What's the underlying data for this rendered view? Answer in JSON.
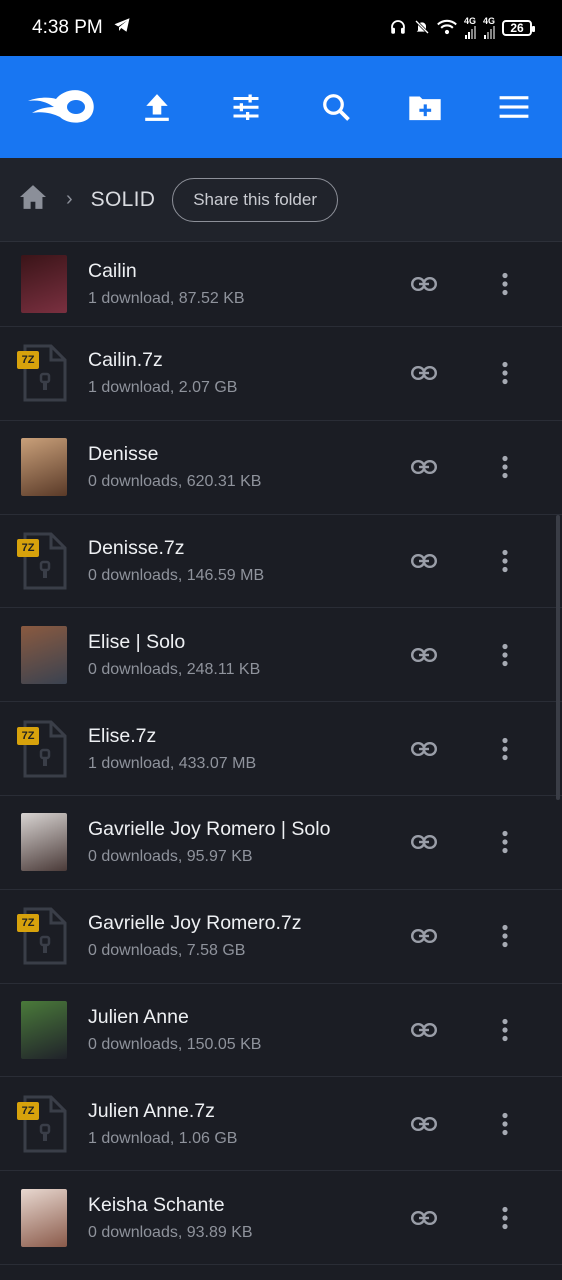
{
  "status_bar": {
    "time": "4:38 PM",
    "network_1": "4G",
    "network_2": "4G",
    "battery": "26"
  },
  "app_bar": {
    "icons": [
      "mediafire-logo",
      "upload-icon",
      "filter-icon",
      "search-icon",
      "new-folder-icon",
      "menu-icon"
    ]
  },
  "breadcrumb": {
    "folder": "SOLID",
    "share_label": "Share this folder"
  },
  "files": [
    {
      "name": "Cailin",
      "info": "1 download, 87.52 KB",
      "type": "image",
      "colors": [
        "#3a1418",
        "#7a3040"
      ]
    },
    {
      "name": "Cailin.7z",
      "info": "1 download, 2.07 GB",
      "type": "7z",
      "badge": "7Z"
    },
    {
      "name": "Denisse",
      "info": "0 downloads, 620.31 KB",
      "type": "image",
      "colors": [
        "#c9a07a",
        "#5a3a28"
      ]
    },
    {
      "name": "Denisse.7z",
      "info": "0 downloads, 146.59 MB",
      "type": "7z",
      "badge": "7Z"
    },
    {
      "name": "Elise | Solo",
      "info": "0 downloads, 248.11 KB",
      "type": "image",
      "colors": [
        "#8a5a40",
        "#3a4250"
      ]
    },
    {
      "name": "Elise.7z",
      "info": "1 download, 433.07 MB",
      "type": "7z",
      "badge": "7Z"
    },
    {
      "name": "Gavrielle Joy Romero | Solo",
      "info": "0 downloads, 95.97 KB",
      "type": "image",
      "colors": [
        "#d8d4d2",
        "#4a3a38"
      ]
    },
    {
      "name": "Gavrielle Joy Romero.7z",
      "info": "0 downloads, 7.58 GB",
      "type": "7z",
      "badge": "7Z"
    },
    {
      "name": "Julien Anne",
      "info": "0 downloads, 150.05 KB",
      "type": "image",
      "colors": [
        "#4a7a3a",
        "#20222a"
      ]
    },
    {
      "name": "Julien Anne.7z",
      "info": "1 download, 1.06 GB",
      "type": "7z",
      "badge": "7Z"
    },
    {
      "name": "Keisha Schante",
      "info": "0 downloads, 93.89 KB",
      "type": "image",
      "colors": [
        "#e8d8d0",
        "#8a5a4a"
      ]
    }
  ]
}
